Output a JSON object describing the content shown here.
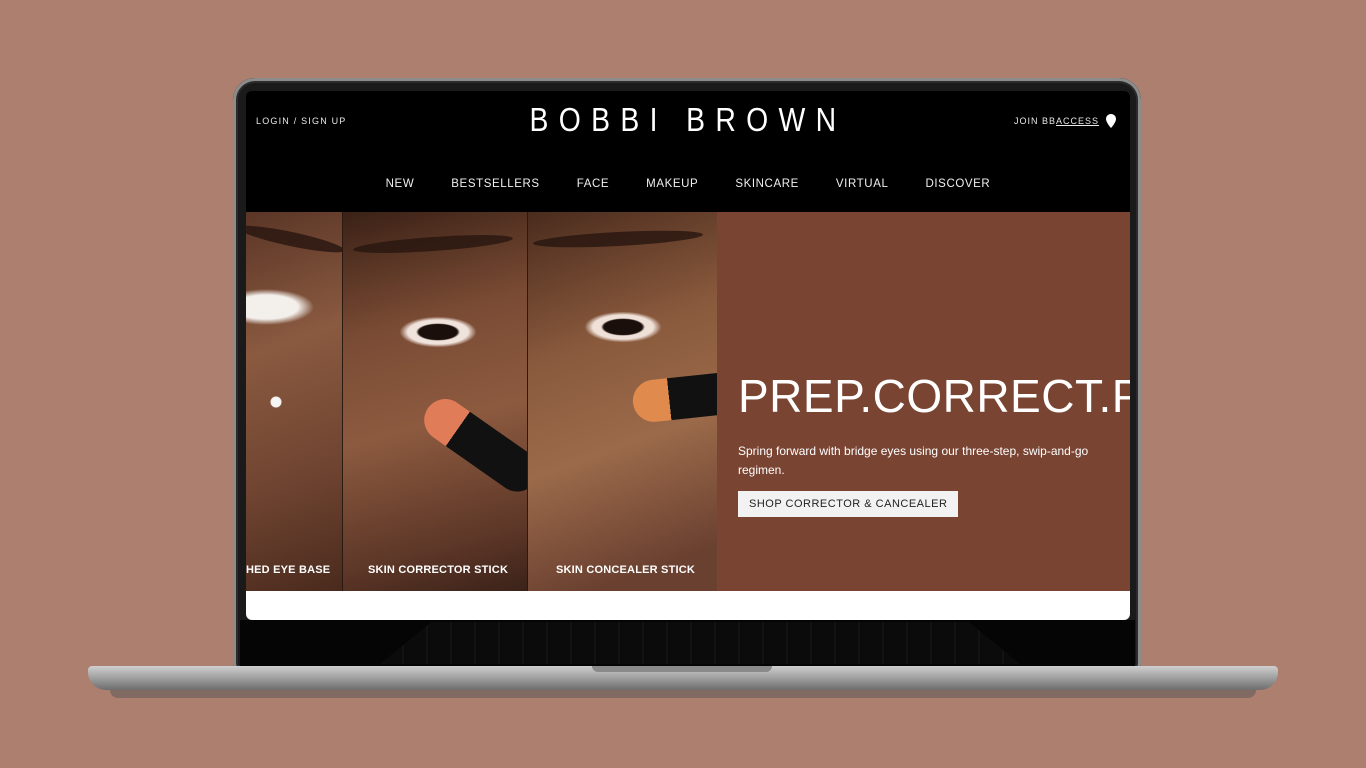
{
  "header": {
    "login_label": "LOGIN / SIGN UP",
    "logo": "BOBBI BROWN",
    "join_prefix": "JOIN BB",
    "join_link": "ACCESS",
    "location_icon": "map-pin-icon"
  },
  "nav": {
    "items": [
      "NEW",
      "BESTSELLERS",
      "FACE",
      "MAKEUP",
      "SKINCARE",
      "VIRTUAL",
      "DISCOVER"
    ]
  },
  "hero": {
    "background_color": "#7a4433",
    "title": "PREP.CORRECT.PER",
    "subtitle": "Spring forward with bridge eyes using our three-step, swip-and-go regimen.",
    "cta_label": "SHOP CORRECTOR & CANCEALER",
    "products": [
      {
        "label": "HED EYE BASE"
      },
      {
        "label": "SKIN CORRECTOR STICK"
      },
      {
        "label": "SKIN CONCEALER STICK"
      }
    ]
  },
  "colors": {
    "page_background": "#ad7f6f",
    "header_background": "#000000",
    "hero_background": "#7a4433"
  }
}
